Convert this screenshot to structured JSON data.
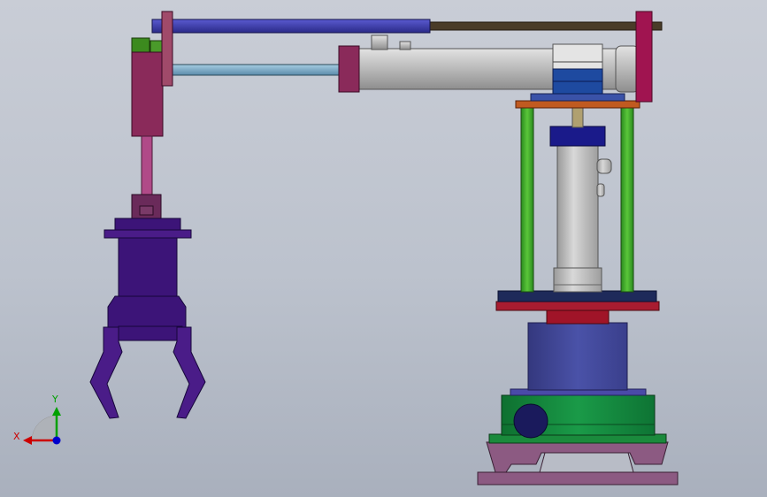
{
  "triad": {
    "x_label": "X",
    "y_label": "Y",
    "x_color": "#cc0000",
    "y_color": "#00a000",
    "z_color": "#0000cc"
  },
  "colors": {
    "background_top": "#c9cdd6",
    "background_bottom": "#a9b0bd",
    "base_plate": "#8c5a82",
    "green_base": "#128a3c",
    "blue_drum": "#3e4696",
    "red_plate": "#a01428",
    "column": "#b4b4b4",
    "green_rods": "#3aa02a",
    "orange_plate": "#c05a20",
    "arm_cylinder": "#b8b8b8",
    "magenta_caps": "#8a2a5a",
    "top_rod_blue": "#3c3ca8",
    "top_rod_brown": "#4a3c28",
    "lower_rod": "#78aac8",
    "gripper_purple": "#3c1478",
    "wrist_green": "#3c8a1e"
  }
}
